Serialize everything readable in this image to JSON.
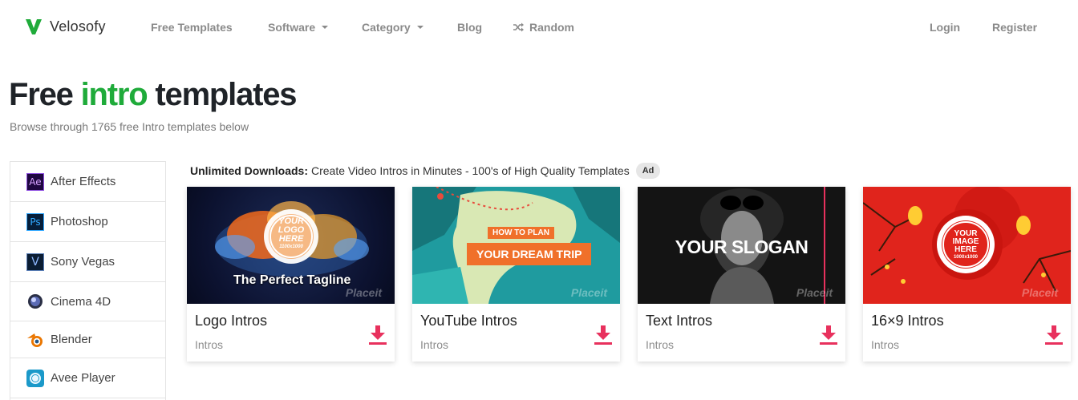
{
  "brand": {
    "name": "Velosofy",
    "logo_color": "#1fab3a"
  },
  "nav": {
    "items": [
      {
        "label": "Free Templates"
      },
      {
        "label": "Software",
        "dropdown": true
      },
      {
        "label": "Category",
        "dropdown": true
      },
      {
        "label": "Blog"
      },
      {
        "label": "Random",
        "icon": "shuffle-icon"
      }
    ],
    "login": "Login",
    "register": "Register"
  },
  "header": {
    "title_before": "Free ",
    "title_accent": "intro",
    "title_after": " templates",
    "accent_color": "#1fab3a",
    "subtitle": "Browse through 1765 free Intro templates below"
  },
  "sidebar": {
    "items": [
      {
        "label": "After Effects",
        "icon": "after-effects-icon",
        "glyph": "Ae"
      },
      {
        "label": "Photoshop",
        "icon": "photoshop-icon",
        "glyph": "Ps"
      },
      {
        "label": "Sony Vegas",
        "icon": "sony-vegas-icon",
        "glyph": "V"
      },
      {
        "label": "Cinema 4D",
        "icon": "cinema-4d-icon"
      },
      {
        "label": "Blender",
        "icon": "blender-icon"
      },
      {
        "label": "Avee Player",
        "icon": "avee-player-icon"
      }
    ]
  },
  "ad": {
    "bold": "Unlimited Downloads:",
    "text": "Create Video Intros in Minutes - 100's of High Quality Templates",
    "badge": "Ad"
  },
  "cards": [
    {
      "title": "Logo Intros",
      "category": "Intros",
      "thumb": {
        "logo_text_1": "YOUR",
        "logo_text_2": "LOGO",
        "logo_text_3": "HERE",
        "logo_size": "1100x1000",
        "tagline": "The Perfect Tagline",
        "watermark": "Placeit"
      }
    },
    {
      "title": "YouTube Intros",
      "category": "Intros",
      "thumb": {
        "line1": "HOW TO PLAN",
        "line2": "YOUR DREAM TRIP",
        "watermark": "Placeit"
      }
    },
    {
      "title": "Text Intros",
      "category": "Intros",
      "thumb": {
        "slogan": "YOUR SLOGAN",
        "watermark": "Placeit"
      }
    },
    {
      "title": "16×9 Intros",
      "category": "Intros",
      "thumb": {
        "line1": "YOUR",
        "line2": "IMAGE",
        "line3": "HERE",
        "size": "1000x1000",
        "watermark": "Placeit"
      }
    }
  ],
  "colors": {
    "download": "#e8315d",
    "nav_text": "#8a8a8a"
  }
}
